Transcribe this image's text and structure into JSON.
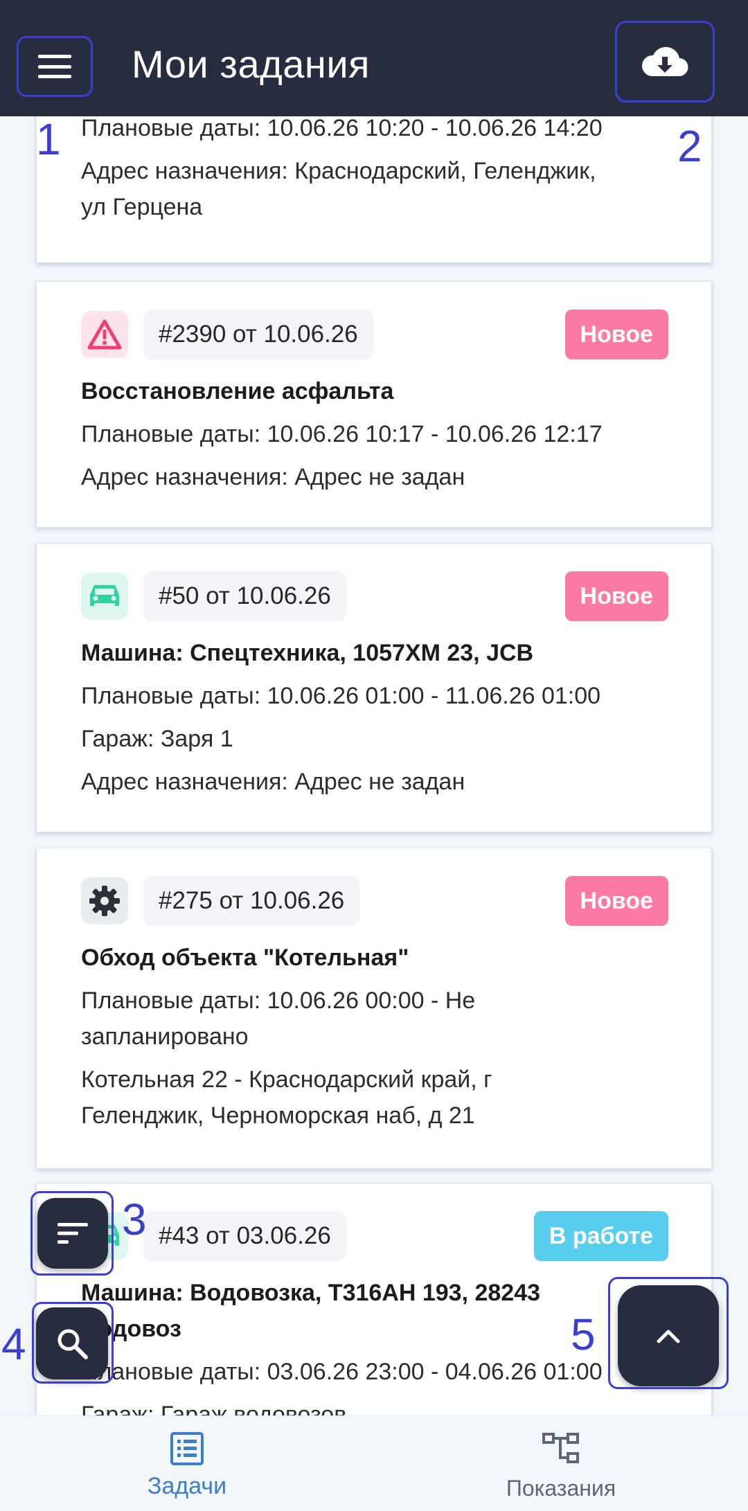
{
  "header": {
    "title": "Мои задания",
    "menu_icon": "hamburger-menu-icon",
    "download_icon": "cloud-download-icon"
  },
  "annotations": [
    "1",
    "2",
    "3",
    "4",
    "5"
  ],
  "cards": [
    {
      "lines": [
        "Плановые даты: 10.06.26 10:20 - 10.06.26 14:20",
        "Адрес назначения: Краснодарский, Геленджик,",
        "ул Герцена"
      ]
    },
    {
      "icon": "warning-icon",
      "number": "#2390 от 10.06.26",
      "status": "Новое",
      "title": "Восстановление асфальта",
      "lines": [
        "Плановые даты: 10.06.26 10:17 - 10.06.26 12:17",
        "Адрес назначения: Адрес не задан"
      ]
    },
    {
      "icon": "car-icon",
      "number": "#50 от 10.06.26",
      "status": "Новое",
      "title": "Машина: Спецтехника, 1057ХМ 23, JCB",
      "lines": [
        "Плановые даты: 10.06.26 01:00 - 11.06.26 01:00",
        "Гараж: Заря 1",
        "Адрес назначения: Адрес не задан"
      ]
    },
    {
      "icon": "gear-icon",
      "number": "#275 от 10.06.26",
      "status": "Новое",
      "title": "Обход объекта \"Котельная\"",
      "lines": [
        "Плановые даты: 10.06.26 00:00 - Не",
        "запланировано",
        "Котельная 22 - Краснодарский край, г",
        "Геленджик, Черноморская наб, д 21"
      ]
    },
    {
      "icon": "car-icon",
      "number": "#43 от 03.06.26",
      "status": "В работе",
      "title_line1": "Машина: Водовозка, Т316АН 193, 28243",
      "title_line2": "Водовоз",
      "lines": [
        "Плановые даты: 03.06.26 23:00 - 04.06.26 01:00",
        "Гараж: Гараж водовозов"
      ]
    }
  ],
  "fabs": {
    "sort_icon": "sort-icon",
    "search_icon": "search-icon",
    "up_icon": "chevron-up-icon"
  },
  "bottom_nav": {
    "tasks_label": "Задачи",
    "readings_label": "Показания",
    "active_color": "#3d7ec8",
    "inactive_color": "#5c6670"
  }
}
